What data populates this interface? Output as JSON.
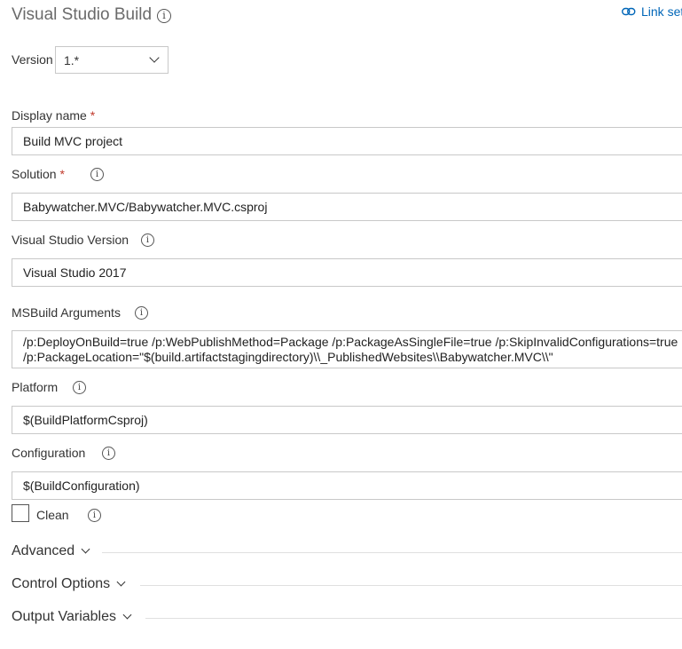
{
  "header": {
    "title": "Visual Studio Build",
    "link_settings": "Link settings"
  },
  "version": {
    "label": "Version",
    "value": "1.*"
  },
  "display_name": {
    "label": "Display name",
    "required_marker": "*",
    "value": "Build MVC project"
  },
  "solution": {
    "label": "Solution",
    "required_marker": "*",
    "value": "Babywatcher.MVC/Babywatcher.MVC.csproj"
  },
  "vs_version": {
    "label": "Visual Studio Version",
    "value": "Visual Studio 2017"
  },
  "msbuild_args": {
    "label": "MSBuild Arguments",
    "line1": "/p:DeployOnBuild=true /p:WebPublishMethod=Package /p:PackageAsSingleFile=true /p:SkipInvalidConfigurations=true",
    "line2": "/p:PackageLocation=\"$(build.artifactstagingdirectory)\\\\_PublishedWebsites\\\\Babywatcher.MVC\\\\\""
  },
  "platform": {
    "label": "Platform",
    "value": "$(BuildPlatformCsproj)"
  },
  "configuration": {
    "label": "Configuration",
    "value": "$(BuildConfiguration)"
  },
  "clean": {
    "label": "Clean",
    "checked": false
  },
  "sections": {
    "advanced": "Advanced",
    "control_options": "Control Options",
    "output_variables": "Output Variables"
  },
  "icons": {
    "info": "info-icon",
    "link": "link-icon",
    "chevron": "chevron-down-icon"
  }
}
